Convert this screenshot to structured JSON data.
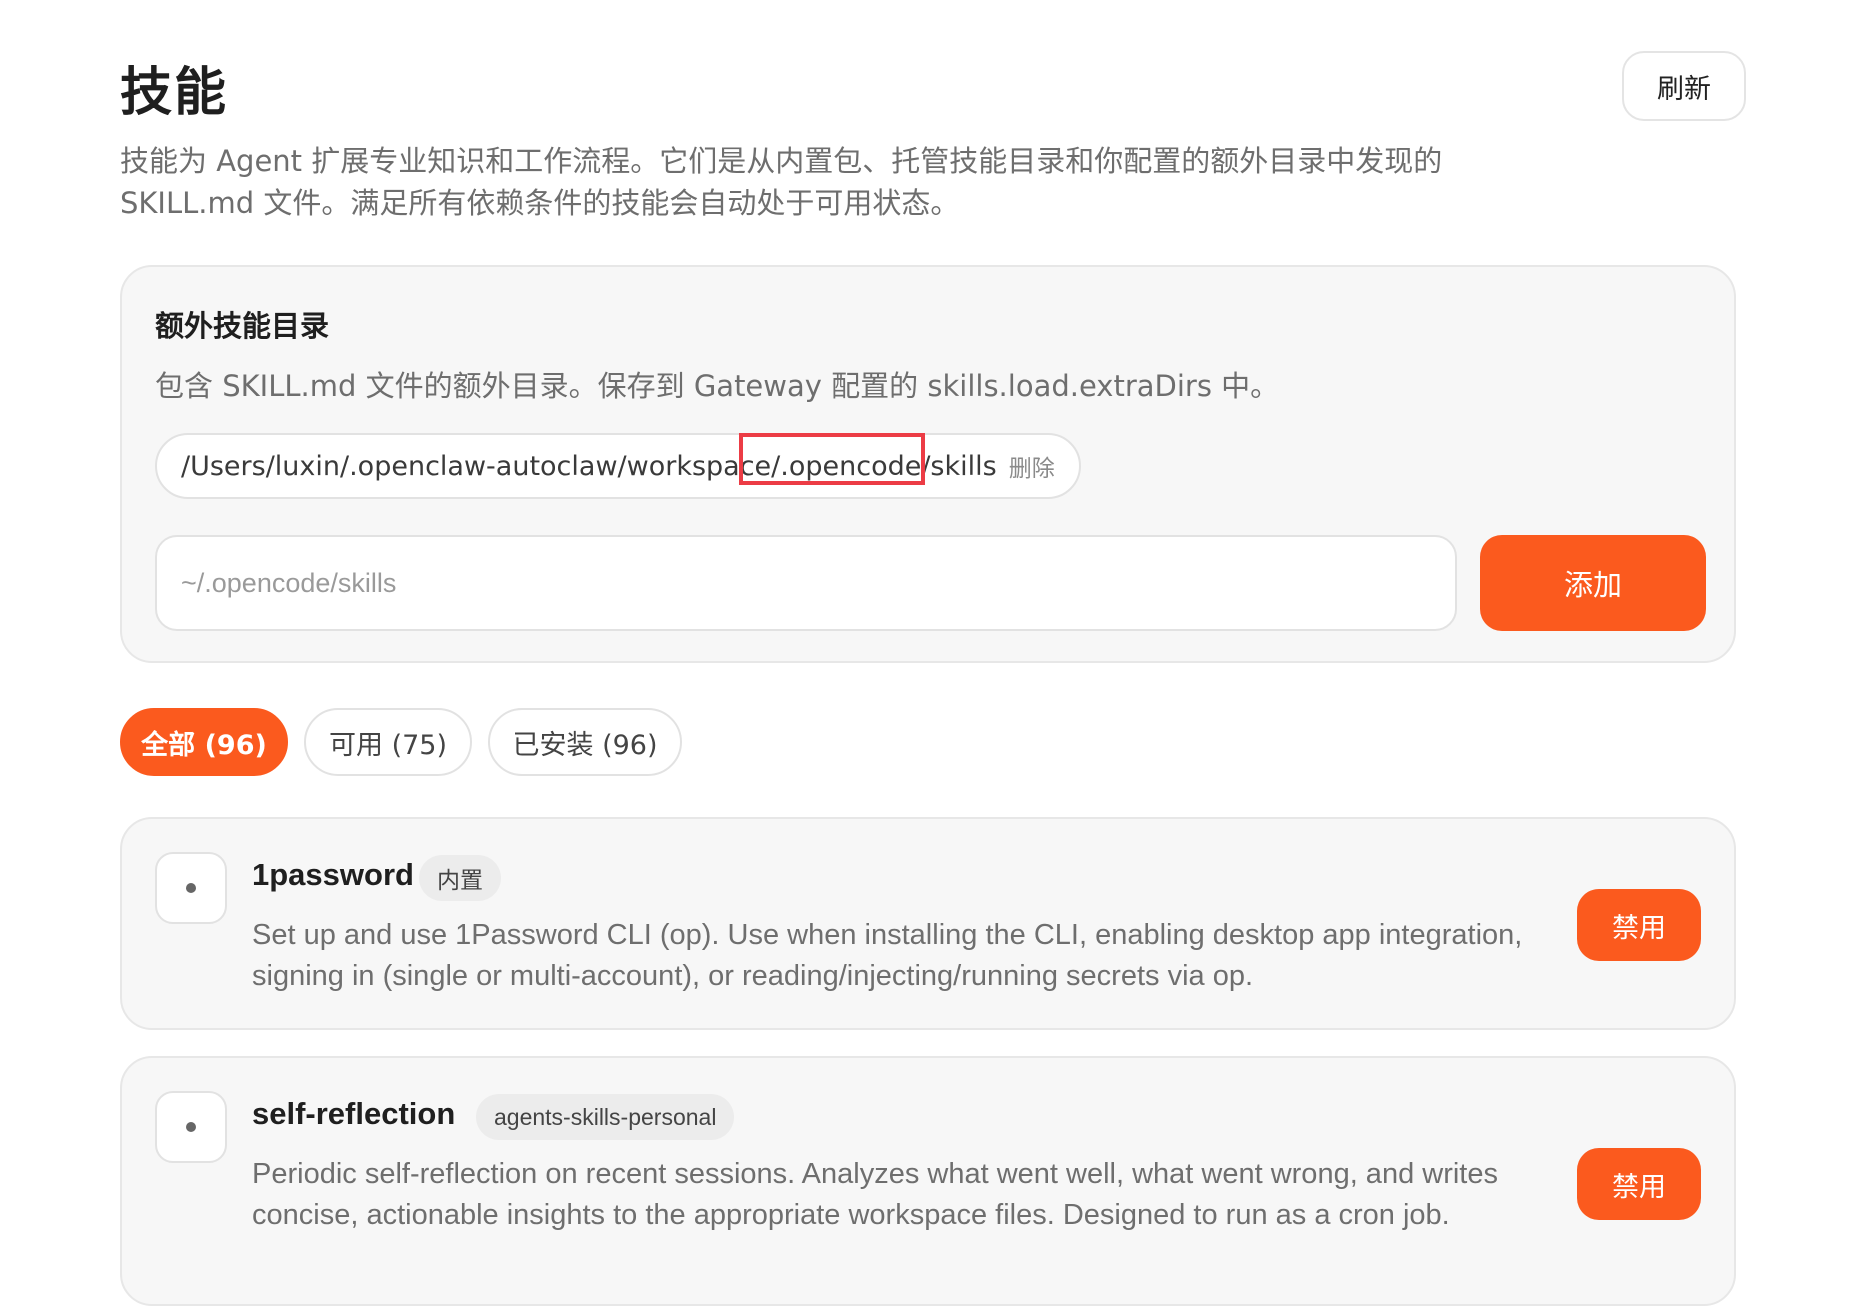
{
  "header": {
    "title": "技能",
    "refresh_label": "刷新",
    "description": "技能为 Agent 扩展专业知识和工作流程。它们是从内置包、托管技能目录和你配置的额外目录中发现的 SKILL.md 文件。满足所有依赖条件的技能会自动处于可用状态。"
  },
  "extra_dirs": {
    "title": "额外技能目录",
    "description": "包含 SKILL.md 文件的额外目录。保存到 Gateway 配置的 skills.load.extraDirs 中。",
    "entries": [
      {
        "path": "/Users/luxin/.openclaw-autoclaw/workspace/.opencode/skills",
        "remove_label": "删除"
      }
    ],
    "input_placeholder": "~/.opencode/skills",
    "add_label": "添加"
  },
  "filters": [
    {
      "label": "全部 (96)",
      "active": true
    },
    {
      "label": "可用 (75)",
      "active": false
    },
    {
      "label": "已安装 (96)",
      "active": false
    }
  ],
  "skills": [
    {
      "name": "1password",
      "badge": "内置",
      "description": "Set up and use 1Password CLI (op). Use when installing the CLI, enabling desktop app integration, signing in (single or multi-account), or reading/injecting/running secrets via op.",
      "action_label": "禁用"
    },
    {
      "name": "self-reflection",
      "badge": "agents-skills-personal",
      "description": "Periodic self-reflection on recent sessions. Analyzes what went well, what went wrong, and writes concise, actionable insights to the appropriate workspace files. Designed to run as a cron job.",
      "action_label": "禁用"
    }
  ],
  "colors": {
    "accent": "#fb5a1e",
    "highlight": "#ec3c45"
  }
}
